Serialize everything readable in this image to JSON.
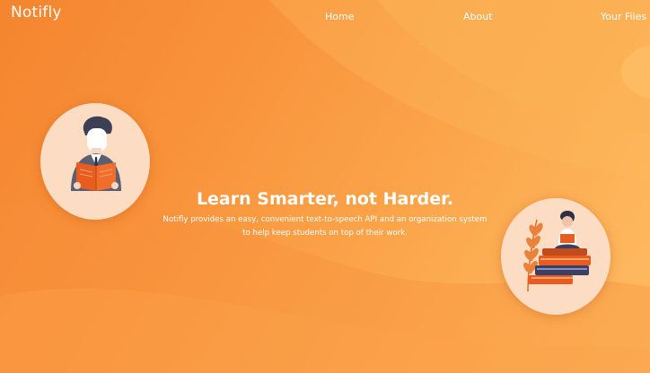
{
  "navbar": {
    "brand": "Notifly",
    "links": [
      {
        "label": "Home"
      },
      {
        "label": "About"
      },
      {
        "label": "Your Files"
      }
    ]
  },
  "hero": {
    "title": "Learn Smarter, not Harder.",
    "description_line1": "Notifly provides an easy, convenient text-to-speech API and an organization system",
    "description_line2": "to help keep students on top of their work."
  },
  "illustrations": {
    "left": "man-reading-book-illustration",
    "right": "woman-reading-on-book-stack-illustration"
  },
  "colors": {
    "background_start": "#f5852f",
    "background_end": "#fdbb62",
    "circle_fill": "#fddcc4",
    "book_orange": "#e85d1f",
    "suit_gray": "#5a5f72",
    "book_navy": "#3a3f66"
  }
}
